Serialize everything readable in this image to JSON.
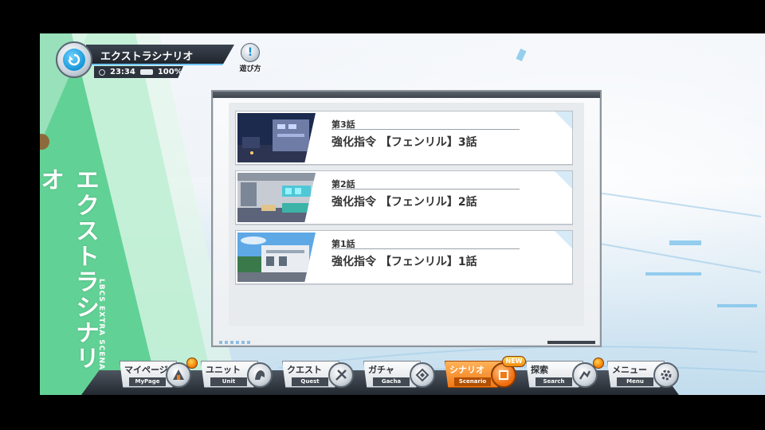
{
  "header": {
    "title": "エクストラシナリオ",
    "time": "23:34",
    "battery": "100%",
    "help_label": "遊び方"
  },
  "banner": {
    "title": "エクストラシナリオ",
    "subtitle": "LBCS EXTRA SCENARIO"
  },
  "episodes": [
    {
      "number": "第3話",
      "title": "強化指令 【フェンリル】3話",
      "scene": "night-street"
    },
    {
      "number": "第2話",
      "title": "強化指令 【フェンリル】2話",
      "scene": "room-interior"
    },
    {
      "number": "第1話",
      "title": "強化指令 【フェンリル】1話",
      "scene": "day-building"
    }
  ],
  "nav": {
    "items": [
      {
        "jp": "マイページ",
        "en": "MyPage",
        "icon": "mypage-icon",
        "badge": true
      },
      {
        "jp": "ユニット",
        "en": "Unit",
        "icon": "unit-icon",
        "badge": false
      },
      {
        "jp": "クエスト",
        "en": "Quest",
        "icon": "quest-icon",
        "badge": false
      },
      {
        "jp": "ガチャ",
        "en": "Gacha",
        "icon": "gacha-icon",
        "badge": false
      },
      {
        "jp": "シナリオ",
        "en": "Scenario",
        "icon": "scenario-icon",
        "badge": false,
        "active": true
      },
      {
        "jp": "探索",
        "en": "Search",
        "icon": "search-icon",
        "badge": true
      },
      {
        "jp": "メニュー",
        "en": "Menu",
        "icon": "gear-icon",
        "badge": false
      }
    ],
    "new_badge": "NEW"
  },
  "colors": {
    "accent_green": "#5fd08e",
    "accent_blue": "#1596d8",
    "active_orange": "#f07a16"
  }
}
